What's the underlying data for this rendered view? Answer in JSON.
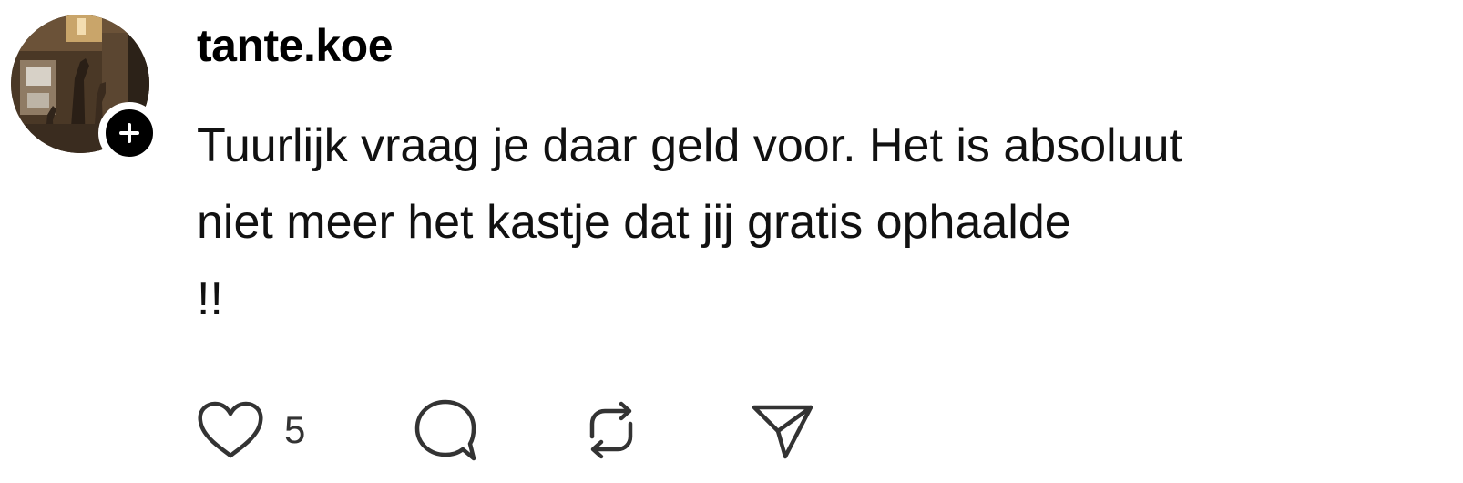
{
  "post": {
    "username": "tante.koe",
    "comment_lines": [
      "Tuurlijk vraag je daar geld voor. Het is absoluut",
      "niet meer het kastje dat jij gratis ophaalde",
      "!!"
    ],
    "likes": "5"
  },
  "icons": {
    "follow": "plus-icon",
    "like": "heart-icon",
    "reply": "speech-bubble-icon",
    "repost": "repost-arrows-icon",
    "share": "paper-plane-icon"
  },
  "colors": {
    "text": "#111111",
    "badge": "#000000",
    "icon": "#333333",
    "background": "#ffffff"
  }
}
